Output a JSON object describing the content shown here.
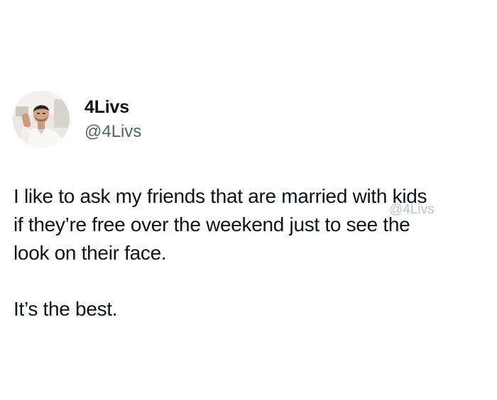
{
  "author": {
    "display_name": "4Livs",
    "handle": "@4Livs",
    "avatar_icon": "profile-photo"
  },
  "tweet": {
    "lines": "I like to ask my friends that are married with kids\nif they’re free over the weekend just to see the\nlook on their face.",
    "closing": "It’s the best."
  },
  "watermark": "@4Livs",
  "colors": {
    "text": "#0f1419",
    "secondary_text": "#536471",
    "background": "#ffffff"
  }
}
